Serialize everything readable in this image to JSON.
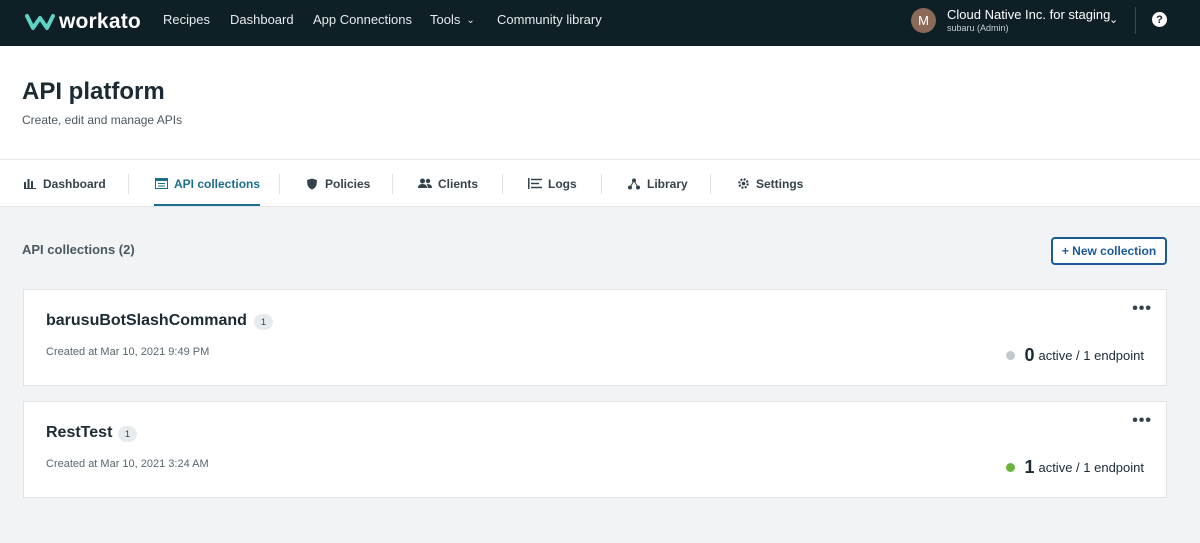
{
  "topnav": {
    "logo": "workato",
    "items": [
      "Recipes",
      "Dashboard",
      "App Connections",
      "Tools",
      "Community library"
    ],
    "account": {
      "initial": "M",
      "name": "Cloud Native Inc. for staging",
      "sub": "subaru (Admin)"
    },
    "help_label": "?"
  },
  "header": {
    "title": "API platform",
    "subtitle": "Create, edit and manage APIs"
  },
  "tabs": [
    "Dashboard",
    "API collections",
    "Policies",
    "Clients",
    "Logs",
    "Library",
    "Settings"
  ],
  "active_tab": "API collections",
  "content": {
    "section_title": "API collections (2)",
    "new_button": "+ New collection"
  },
  "collections": [
    {
      "name": "barusuBotSlashCommand",
      "badge": "1",
      "created": "Created at Mar 10, 2021 9:49 PM",
      "active_count": "0",
      "active_suffix": "active / 1 endpoint",
      "status_color": "#c2c8cc"
    },
    {
      "name": "RestTest",
      "badge": "1",
      "created": "Created at Mar 10, 2021 3:24 AM",
      "active_count": "1",
      "active_suffix": "active / 1 endpoint",
      "status_color": "#6cb33f"
    }
  ],
  "colors": {
    "nav_bg": "#0f1f26",
    "accent": "#1c6f8c",
    "button": "#1c5a9c"
  }
}
